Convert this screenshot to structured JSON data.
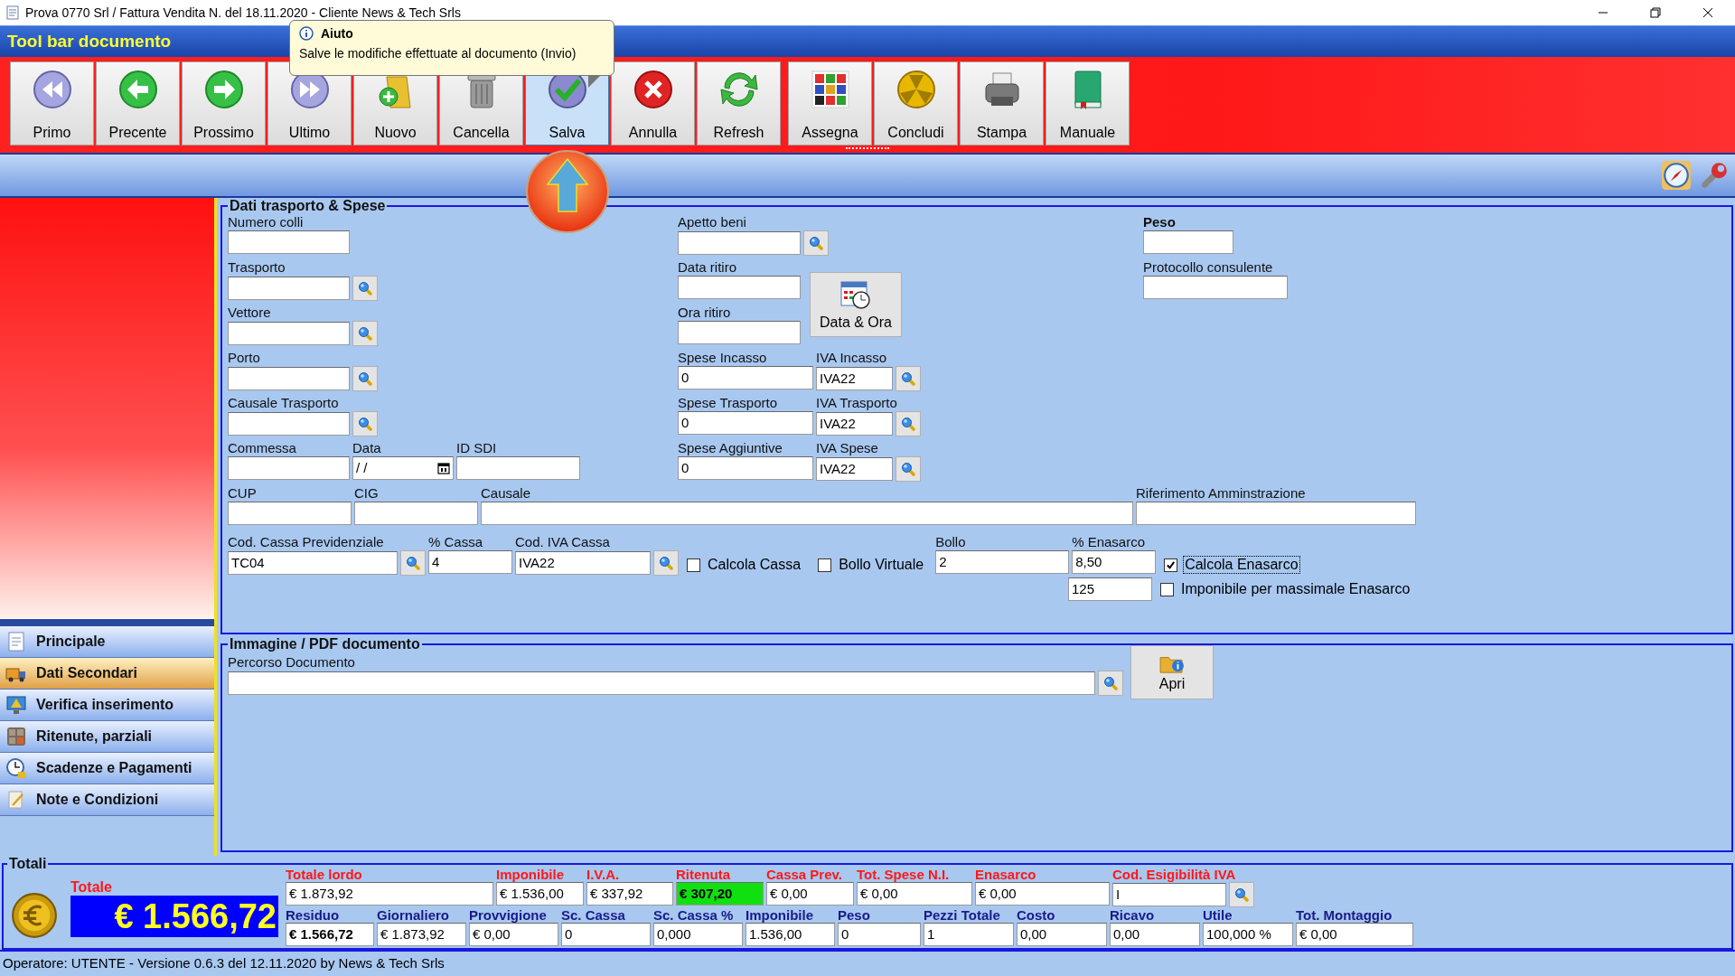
{
  "window": {
    "title": "Prova 0770 Srl / Fattura Vendita N.  del 18.11.2020 - Cliente News & Tech Srls"
  },
  "toolbar": {
    "title": "Tool bar documento",
    "groups": [
      {
        "buttons": [
          {
            "label": "Primo",
            "selected": false
          },
          {
            "label": "Precente",
            "selected": false
          },
          {
            "label": "Prossimo",
            "selected": false
          },
          {
            "label": "Ultimo",
            "selected": false
          },
          {
            "label": "Nuovo",
            "selected": false
          },
          {
            "label": "Cancella",
            "selected": false
          },
          {
            "label": "Salva",
            "selected": true
          },
          {
            "label": "Annulla",
            "selected": false
          },
          {
            "label": "Refresh",
            "selected": false
          }
        ]
      },
      {
        "buttons": [
          {
            "label": "Assegna",
            "selected": false
          },
          {
            "label": "Concludi",
            "selected": false
          },
          {
            "label": "Stampa",
            "selected": false
          },
          {
            "label": "Manuale",
            "selected": false
          }
        ]
      }
    ]
  },
  "tooltip": {
    "title": "Aiuto",
    "text": "Salve le modifiche effettuate al documento (Invio)"
  },
  "sidebar": {
    "items": [
      {
        "label": "Principale",
        "selected": false
      },
      {
        "label": "Dati Secondari",
        "selected": true
      },
      {
        "label": "Verifica inserimento",
        "selected": false
      },
      {
        "label": "Ritenute, parziali",
        "selected": false
      },
      {
        "label": "Scadenze e Pagamenti",
        "selected": false
      },
      {
        "label": "Note e Condizioni",
        "selected": false
      }
    ]
  },
  "transport": {
    "title": "Dati trasporto & Spese",
    "left": [
      {
        "fields": [
          {
            "label": "Numero colli",
            "kind": "text"
          }
        ]
      },
      {
        "fields": [
          {
            "label": "Trasporto",
            "kind": "lookup"
          }
        ]
      },
      {
        "fields": [
          {
            "label": "Vettore",
            "kind": "lookup"
          }
        ]
      },
      {
        "fields": [
          {
            "label": "Porto",
            "kind": "lookup"
          }
        ]
      },
      {
        "fields": [
          {
            "label": "Causale Trasporto",
            "kind": "lookup"
          }
        ]
      },
      {
        "fields": [
          {
            "label": "Commessa",
            "kind": "text"
          },
          {
            "label": "Data",
            "kind": "date",
            "value": " /  /"
          },
          {
            "label": "ID SDI",
            "kind": "text"
          }
        ]
      }
    ],
    "middle": [
      {
        "fields": [
          {
            "label": "Apetto beni",
            "kind": "lookup"
          }
        ]
      },
      {
        "fields": [
          {
            "label": "Data ritiro",
            "kind": "text"
          }
        ]
      },
      {
        "fields": [
          {
            "label": "Ora ritiro",
            "kind": "text"
          }
        ]
      },
      {
        "fields": [
          {
            "label": "Spese Incasso",
            "kind": "text",
            "value": "0"
          },
          {
            "label": "IVA Incasso",
            "kind": "lookup",
            "value": "IVA22"
          }
        ]
      },
      {
        "fields": [
          {
            "label": "Spese Trasporto",
            "kind": "text",
            "value": "0"
          },
          {
            "label": "IVA Trasporto",
            "kind": "lookup",
            "value": "IVA22"
          }
        ]
      },
      {
        "fields": [
          {
            "label": "Spese Aggiuntive",
            "kind": "text",
            "value": "0"
          },
          {
            "label": "IVA Spese",
            "kind": "lookup",
            "value": "IVA22"
          }
        ]
      }
    ],
    "date_time_button": "Data & Ora",
    "right": [
      {
        "fields": [
          {
            "label": "Peso",
            "kind": "text",
            "bold": true
          }
        ]
      },
      {
        "fields": [
          {
            "label": "Protocollo consulente",
            "kind": "text"
          }
        ]
      }
    ],
    "rows": [
      {
        "fields": [
          {
            "label": "CUP",
            "kind": "text"
          },
          {
            "label": "CIG",
            "kind": "text"
          },
          {
            "label": "Causale",
            "kind": "text"
          },
          {
            "label": "Riferimento Amminstrazione",
            "kind": "text"
          }
        ]
      },
      {
        "fields": [
          {
            "label": "Cod. Cassa Previdenziale",
            "kind": "lookup",
            "value": "TC04"
          },
          {
            "label": "% Cassa",
            "kind": "text",
            "value": "4"
          },
          {
            "label": "Cod. IVA Cassa",
            "kind": "lookup",
            "value": "IVA22"
          },
          {
            "label": "Calcola Cassa",
            "kind": "check",
            "checked": false
          },
          {
            "label": "Bollo Virtuale",
            "kind": "check",
            "checked": false
          },
          {
            "label": "Bollo",
            "kind": "text",
            "value": "2"
          },
          {
            "label": "% Enasarco",
            "kind": "text",
            "value": "8,50"
          },
          {
            "label": "Calcola Enasarco",
            "kind": "check",
            "checked": true,
            "focused": true
          }
        ]
      },
      {
        "fields": [
          {
            "kind": "text",
            "value": "125"
          },
          {
            "label": "Imponibile per massimale Enasarco",
            "kind": "check",
            "checked": false
          }
        ]
      }
    ]
  },
  "document_image": {
    "title": "Immagine / PDF documento",
    "path_label": "Percorso Documento",
    "open_button": "Apri"
  },
  "totals": {
    "title": "Totali",
    "total_label": "Totale",
    "total_value": "€ 1.566,72",
    "row_1": [
      {
        "label": "Totale lordo",
        "kind": "amount",
        "value": "€ 1.873,92",
        "highlight": false
      },
      {
        "label": "Imponibile",
        "kind": "amount",
        "value": "€ 1.536,00",
        "highlight": false
      },
      {
        "label": "I.V.A.",
        "kind": "amount",
        "value": "€ 337,92",
        "highlight": false
      },
      {
        "label": "Ritenuta",
        "kind": "amount",
        "value": "€ 307,20",
        "highlight": true
      },
      {
        "label": "Cassa Prev.",
        "kind": "amount",
        "value": "€ 0,00",
        "highlight": false
      },
      {
        "label": "Tot. Spese N.I.",
        "kind": "amount",
        "value": "€ 0,00",
        "highlight": false
      },
      {
        "label": "Enasarco",
        "kind": "amount",
        "value": "€ 0,00",
        "highlight": false
      },
      {
        "label": "Cod. Esigibilità IVA",
        "kind": "lookup",
        "value": "I",
        "highlight": false
      }
    ],
    "row_2": [
      {
        "label": "Residuo",
        "value": "€ 1.566,72",
        "bold": true
      },
      {
        "label": "Giornaliero",
        "value": "€ 1.873,92"
      },
      {
        "label": "Provvigione",
        "value": "€ 0,00"
      },
      {
        "label": "Sc. Cassa",
        "value": "0"
      },
      {
        "label": "Sc. Cassa %",
        "value": "0,000"
      },
      {
        "label": "Imponibile",
        "value": "1.536,00"
      },
      {
        "label": "Peso",
        "value": "0"
      },
      {
        "label": "Pezzi Totale",
        "value": "1"
      },
      {
        "label": "Costo",
        "value": "0,00"
      },
      {
        "label": "Ricavo",
        "value": "0,00"
      },
      {
        "label": "Utile",
        "value": "100,000 %"
      },
      {
        "label": "Tot. Montaggio",
        "value": "€ 0,00"
      }
    ]
  },
  "status_bar": "Operatore: UTENTE - Versione 0.6.3 del 12.11.2020 by News & Tech Srls"
}
